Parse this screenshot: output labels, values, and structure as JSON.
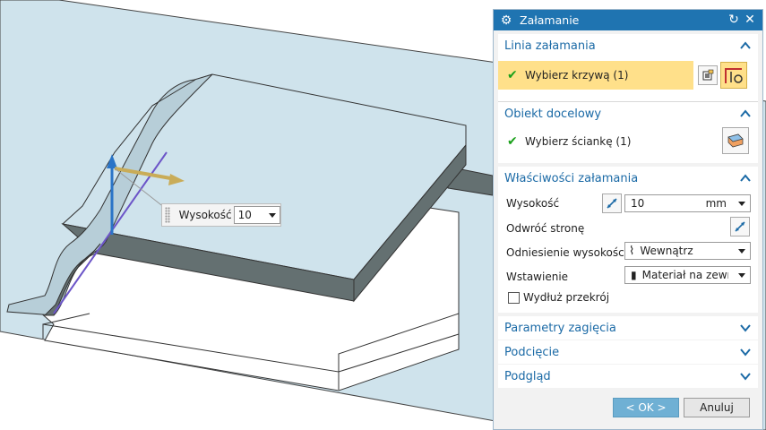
{
  "viewport": {
    "float_input": {
      "label": "Wysokość",
      "value": "10"
    }
  },
  "dialog": {
    "title": "Załamanie",
    "title_icons": [
      "gear-icon",
      "reset-icon",
      "close-icon"
    ],
    "sections": {
      "bend_line": {
        "header": "Linia załamania",
        "select_curve": "Wybierz krzywą (1)",
        "state": "expanded"
      },
      "target": {
        "header": "Obiekt docelowy",
        "select_face": "Wybierz ściankę (1)",
        "state": "expanded"
      },
      "props": {
        "header": "Właściwości załamania",
        "height_label": "Wysokość",
        "height_value": "10",
        "height_unit": "mm",
        "reverse_label": "Odwróć stronę",
        "height_ref_label": "Odniesienie wysokości",
        "height_ref_value": "Wewnątrz",
        "inset_label": "Wstawienie",
        "inset_value": "Materiał na zewnątrz",
        "extend_label": "Wydłuż przekrój",
        "extend_checked": false,
        "state": "expanded"
      },
      "bend_params": {
        "header": "Parametry zagięcia",
        "state": "collapsed"
      },
      "relief": {
        "header": "Podcięcie",
        "state": "collapsed"
      },
      "preview": {
        "header": "Podgląd",
        "state": "collapsed"
      }
    },
    "ok_label": "< OK >",
    "cancel_label": "Anuluj"
  },
  "colors": {
    "background_plane": "#cfe3ec",
    "part_top": "#cfe3ec",
    "part_side": "#647071",
    "titlebar": "#1f74b1",
    "section_header_text": "#1b6aa6",
    "selection_highlight": "#ffe08a",
    "ok_button": "#6fb0d4"
  }
}
